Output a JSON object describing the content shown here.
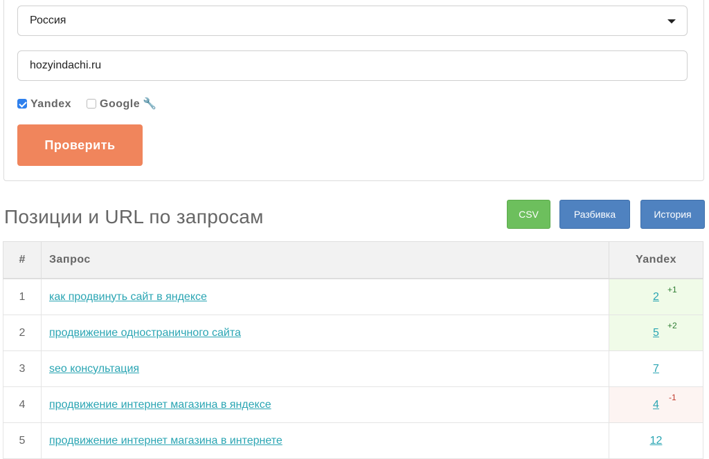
{
  "form": {
    "region_value": "Россия",
    "domain_value": "hozyindachi.ru",
    "engines": [
      {
        "label": "Yandex",
        "checked": true
      },
      {
        "label": "Google",
        "checked": false
      }
    ],
    "submit_label": "Проверить"
  },
  "results": {
    "title": "Позиции и URL по запросам",
    "buttons": {
      "csv": "CSV",
      "split": "Разбивка",
      "history": "История"
    },
    "columns": {
      "num": "#",
      "query": "Запрос",
      "engine": "Yandex"
    },
    "rows": [
      {
        "num": "1",
        "query": "как продвинуть сайт в яндексе",
        "position": "2",
        "delta": "+1",
        "trend": "up"
      },
      {
        "num": "2",
        "query": "продвижение одностраничного сайта",
        "position": "5",
        "delta": "+2",
        "trend": "up"
      },
      {
        "num": "3",
        "query": "seo консультация",
        "position": "7",
        "delta": "",
        "trend": "none"
      },
      {
        "num": "4",
        "query": "продвижение интернет магазина в яндексе",
        "position": "4",
        "delta": "-1",
        "trend": "down"
      },
      {
        "num": "5",
        "query": "продвижение интернет магазина в интернете",
        "position": "12",
        "delta": "",
        "trend": "none"
      }
    ]
  },
  "colors": {
    "accent_button": "#f0855c",
    "csv_button": "#6dbf5d",
    "blue_button": "#4f82c0",
    "link": "#2aa5b3",
    "improved_bg": "#f0fbe8",
    "declined_bg": "#fdf4f2"
  },
  "icons": {
    "wrench": "wrench-icon",
    "select_caret": "caret-down-icon",
    "checkbox": "checkbox-icon"
  }
}
